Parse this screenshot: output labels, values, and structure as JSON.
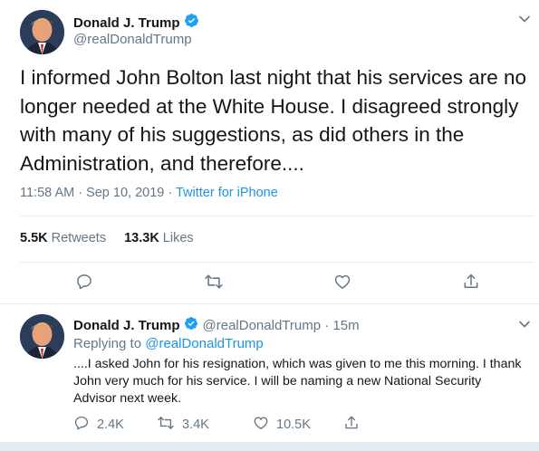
{
  "main_tweet": {
    "author_name": "Donald J. Trump",
    "handle": "@realDonaldTrump",
    "text": "I informed John Bolton last night that his services are no longer needed at the White House. I disagreed strongly with many of his suggestions, as did others in the Administration, and therefore....",
    "time": "11:58 AM · Sep 10, 2019 · ",
    "source": "Twitter for iPhone",
    "retweets_count": "5.5K",
    "retweets_label": "Retweets",
    "likes_count": "13.3K",
    "likes_label": "Likes",
    "actions": [
      "reply-icon",
      "retweet-icon",
      "like-icon",
      "share-icon"
    ]
  },
  "reply_tweet": {
    "author_name": "Donald J. Trump",
    "handle_time": "@realDonaldTrump · 15m",
    "replying_prefix": "Replying to ",
    "replying_to": "@realDonaldTrump",
    "text": "....I asked John for his resignation, which was given to me this morning. I thank John very much for his service. I will be naming a new National Security Advisor next week.",
    "reply_count": "2.4K",
    "retweet_count": "3.4K",
    "like_count": "10.5K"
  },
  "colors": {
    "accent": "#1b95e0",
    "verified": "#1da1f2",
    "secondary_text": "#657786",
    "divider": "#e6ecf0"
  }
}
